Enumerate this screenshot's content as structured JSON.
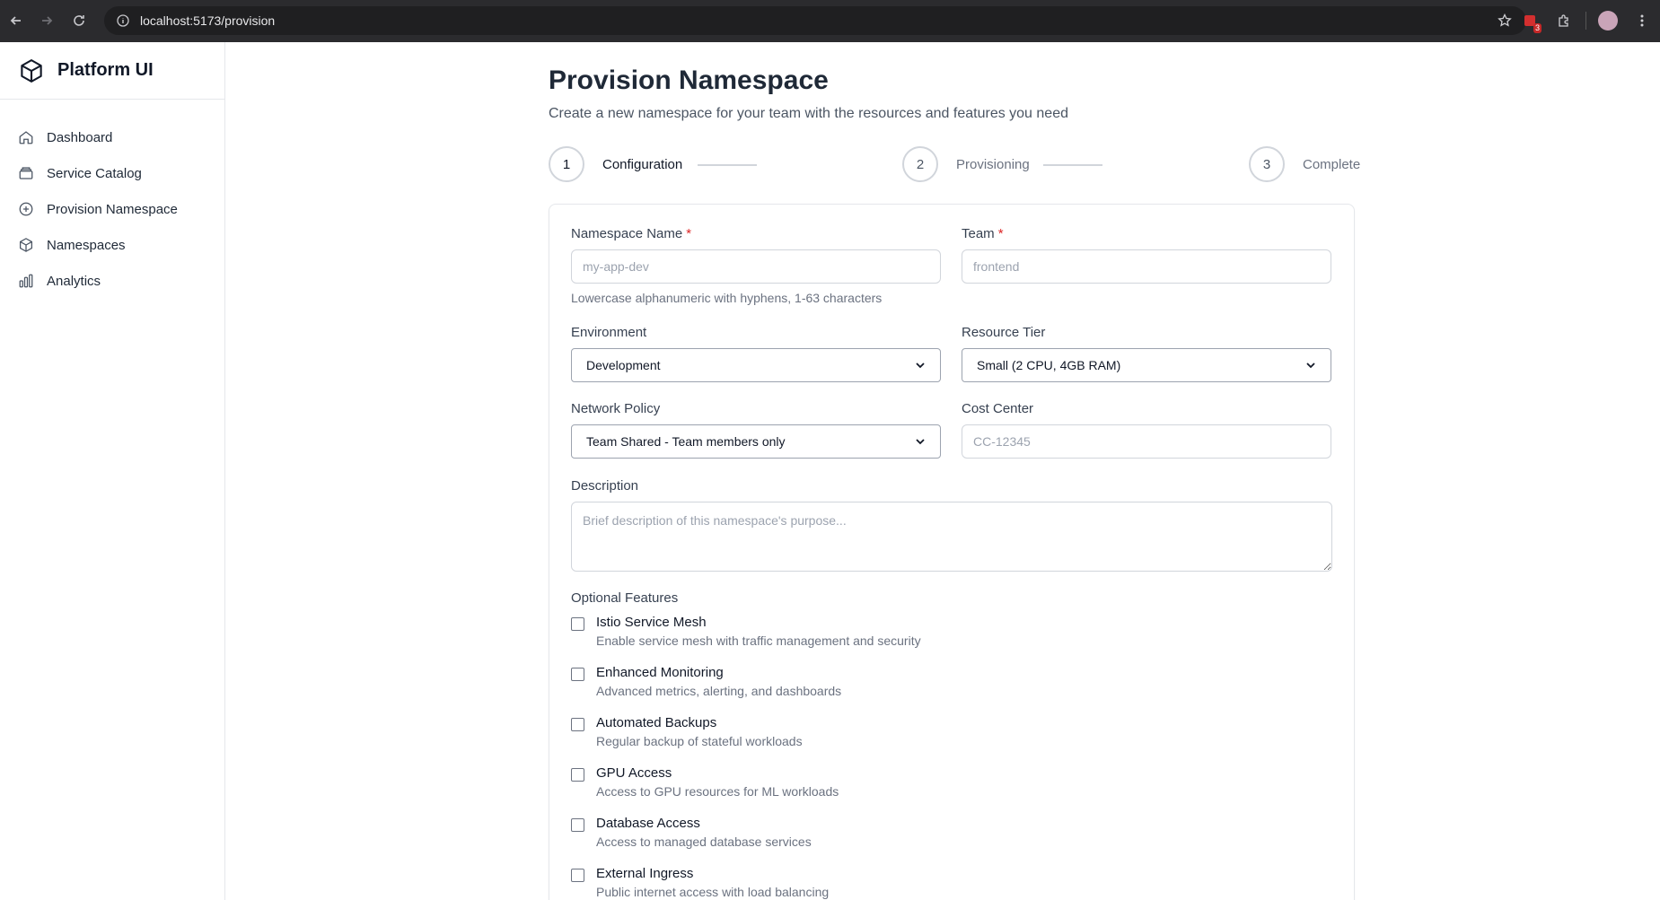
{
  "browser": {
    "url": "localhost:5173/provision",
    "extension_badge": "3"
  },
  "sidebar": {
    "brand": "Platform UI",
    "items": [
      {
        "label": "Dashboard",
        "icon": "home-icon"
      },
      {
        "label": "Service Catalog",
        "icon": "catalog-icon"
      },
      {
        "label": "Provision Namespace",
        "icon": "plus-circle-icon"
      },
      {
        "label": "Namespaces",
        "icon": "cube-icon"
      },
      {
        "label": "Analytics",
        "icon": "bar-chart-icon"
      }
    ]
  },
  "page": {
    "title": "Provision Namespace",
    "subtitle": "Create a new namespace for your team with the resources and features you need"
  },
  "stepper": {
    "steps": [
      {
        "number": "1",
        "label": "Configuration",
        "active": true
      },
      {
        "number": "2",
        "label": "Provisioning",
        "active": false
      },
      {
        "number": "3",
        "label": "Complete",
        "active": false
      }
    ]
  },
  "form": {
    "namespace_name": {
      "label": "Namespace Name",
      "required_mark": "*",
      "placeholder": "my-app-dev",
      "value": "",
      "hint": "Lowercase alphanumeric with hyphens, 1-63 characters"
    },
    "team": {
      "label": "Team",
      "required_mark": "*",
      "placeholder": "frontend",
      "value": ""
    },
    "environment": {
      "label": "Environment",
      "value": "Development"
    },
    "resource_tier": {
      "label": "Resource Tier",
      "value": "Small (2 CPU, 4GB RAM)"
    },
    "network_policy": {
      "label": "Network Policy",
      "value": "Team Shared - Team members only"
    },
    "cost_center": {
      "label": "Cost Center",
      "placeholder": "CC-12345",
      "value": ""
    },
    "description": {
      "label": "Description",
      "placeholder": "Brief description of this namespace's purpose..."
    },
    "optional_features": {
      "label": "Optional Features",
      "items": [
        {
          "title": "Istio Service Mesh",
          "description": "Enable service mesh with traffic management and security",
          "checked": false
        },
        {
          "title": "Enhanced Monitoring",
          "description": "Advanced metrics, alerting, and dashboards",
          "checked": false
        },
        {
          "title": "Automated Backups",
          "description": "Regular backup of stateful workloads",
          "checked": false
        },
        {
          "title": "GPU Access",
          "description": "Access to GPU resources for ML workloads",
          "checked": false
        },
        {
          "title": "Database Access",
          "description": "Access to managed database services",
          "checked": false
        },
        {
          "title": "External Ingress",
          "description": "Public internet access with load balancing",
          "checked": false
        }
      ]
    }
  }
}
